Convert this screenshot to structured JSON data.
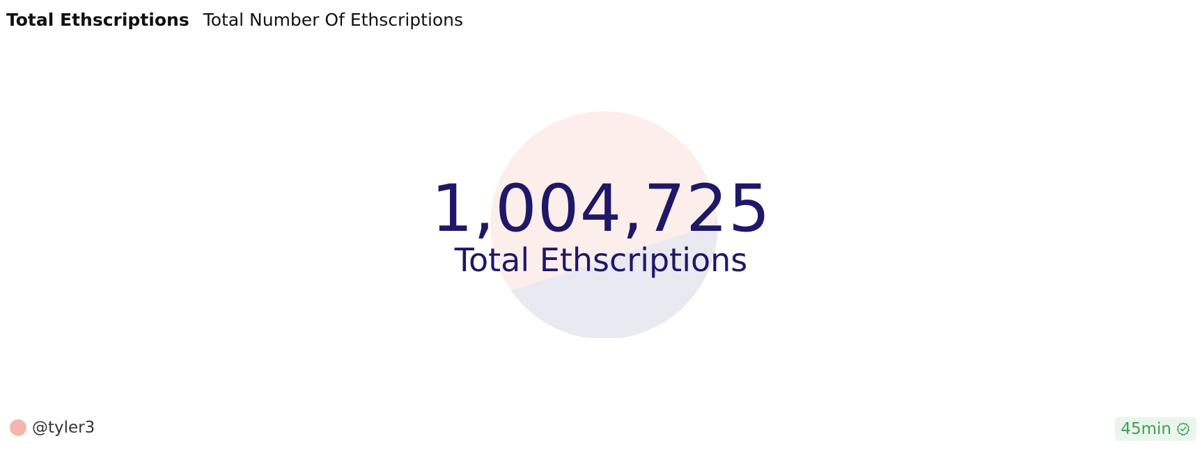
{
  "header": {
    "title": "Total Ethscriptions",
    "subtitle": "Total Number Of Ethscriptions"
  },
  "counter": {
    "value": "1,004,725",
    "label": "Total Ethscriptions",
    "color": "#1f1868",
    "decoration_colors": [
      "#fcefeb",
      "#e9eaf1"
    ]
  },
  "footer": {
    "author": "@tyler3",
    "avatar_color": "#f4b6ac",
    "freshness": "45min",
    "freshness_icon": "check-badge-icon",
    "freshness_color": "#3f9e58"
  }
}
